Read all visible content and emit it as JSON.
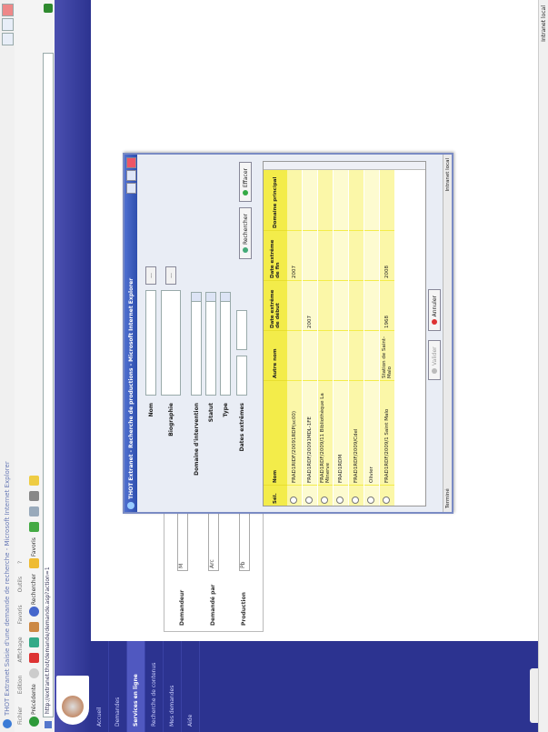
{
  "window": {
    "title": "THOT Extranet Saisie d'une demande de recherche - Microsoft Internet Explorer"
  },
  "menubar": [
    "Fichier",
    "Edition",
    "Affichage",
    "Favoris",
    "Outils",
    "?"
  ],
  "toolbar": {
    "back": "Précédente",
    "search": "Rechercher",
    "favorites": "Favoris"
  },
  "address": {
    "value": "http://extranet.thot/demande/demande.asp?action=1"
  },
  "sidenav": {
    "items": [
      "Accueil",
      "Demandes",
      "Services en ligne",
      "Recherche de contenus",
      "Mes demandes",
      "Aide"
    ]
  },
  "search_panel": {
    "rows": [
      {
        "label": "Demandeur",
        "value": "M"
      },
      {
        "label": "Demandé par",
        "value": "Arc"
      },
      {
        "label": "Production",
        "value": "Pb"
      }
    ]
  },
  "popup": {
    "title": "THOT Extranet - Recherche de productions - Microsoft Internet Explorer",
    "form": {
      "nom": "Nom",
      "biographie": "Biographie",
      "domaine": "Domaine d'intervention",
      "statut": "Statut",
      "type": "Type",
      "dates": "Dates extrêmes",
      "btn_ellipsis": "...",
      "btn_search": "Rechercher",
      "btn_clear": "Effacer"
    },
    "table": {
      "headers": [
        "Sél.",
        "Nom",
        "Autre nom",
        "Date extrême de début",
        "Date extrême de fin",
        "Domaine principal"
      ],
      "rows": [
        [
          "FRAD1RIDF/20091RDP(sc00)",
          "",
          "",
          "2007",
          ""
        ],
        [
          "FRAD1RDF/20091MDL-1FE",
          "",
          "2007",
          "",
          ""
        ],
        [
          "FRAD1RDF/2009/11 Bibliothèque La Minerve",
          "",
          "",
          "",
          ""
        ],
        [
          "FRAD1RDM",
          "",
          "",
          "",
          ""
        ],
        [
          "FRAD1RDF/2009/Cdel",
          "",
          "",
          "",
          ""
        ],
        [
          "Olivier",
          "",
          "",
          "",
          ""
        ],
        [
          "FRAD1RDF/2009/1 Saint Malo",
          "Station de Saint-Malo",
          "1968",
          "2008",
          ""
        ]
      ]
    },
    "footer": {
      "validate": "Valider",
      "cancel": "Annuler"
    },
    "status": {
      "left": "Terminé",
      "right": "Intranet local"
    }
  },
  "statusbar": {
    "right": "Intranet local"
  }
}
